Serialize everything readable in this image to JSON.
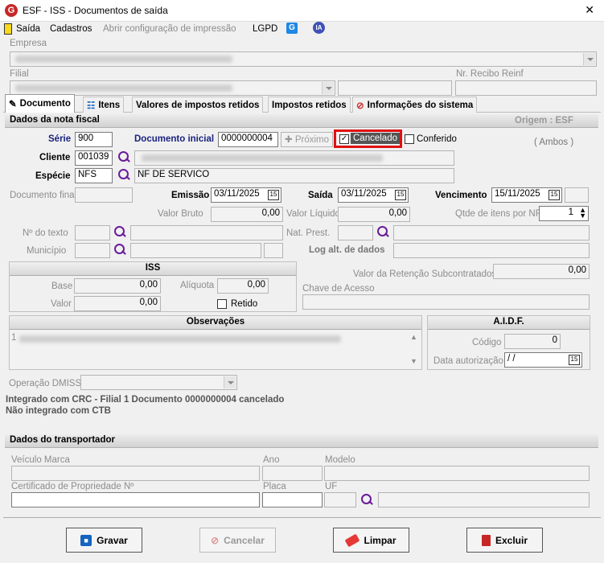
{
  "window": {
    "title": "ESF - ISS - Documentos de saída",
    "close": "✕"
  },
  "menu": {
    "saida": "Saída",
    "cadastros": "Cadastros",
    "impressao": "Abrir configuração de impressão",
    "lgpd": "LGPD",
    "ia": "IA"
  },
  "empresa": {
    "label": "Empresa"
  },
  "filial": {
    "label": "Filial",
    "recibo_label": "Nr. Recibo Reinf"
  },
  "tabs": [
    {
      "label": "Documento"
    },
    {
      "label": "Itens"
    },
    {
      "label": "Valores de impostos retidos"
    },
    {
      "label": "Impostos retidos"
    },
    {
      "label": "Informações do sistema"
    }
  ],
  "nota": {
    "header": "Dados da nota fiscal",
    "origem": "Origem : ESF",
    "serie_label": "Série",
    "serie": "900",
    "doc_inicial_label": "Documento inicial",
    "doc_inicial": "0000000004",
    "proximo": "Próximo",
    "cancelado": "Cancelado",
    "conferido": "Conferido",
    "ambos": "( Ambos )",
    "cliente_label": "Cliente",
    "cliente": "001039",
    "especie_label": "Espécie",
    "especie": "NFS",
    "especie_desc": "NF DE SERVICO",
    "doc_final_label": "Documento final",
    "emissao_label": "Emissão",
    "emissao": "03/11/2025",
    "saida_label": "Saída",
    "saida": "03/11/2025",
    "vencimento_label": "Vencimento",
    "vencimento": "15/11/2025",
    "valor_bruto_label": "Valor Bruto",
    "valor_bruto": "0,00",
    "valor_liquido_label": "Valor Líquido",
    "valor_liquido": "0,00",
    "qtde_label": "Qtde de itens por NF",
    "qtde": "1",
    "nr_texto_label": "Nº do texto",
    "nat_prest_label": "Nat. Prest.",
    "municipio_label": "Município",
    "log_label": "Log alt. de dados",
    "cal": "15"
  },
  "iss": {
    "header": "ISS",
    "base_label": "Base",
    "base": "0,00",
    "aliquota_label": "Alíquota",
    "aliquota": "0,00",
    "valor_label": "Valor",
    "valor": "0,00",
    "retido": "Retido"
  },
  "retencao": {
    "label": "Valor da Retenção Subcontratados",
    "value": "0,00",
    "chave_label": "Chave de Acesso"
  },
  "obs": {
    "header": "Observações",
    "line": "1"
  },
  "aidf": {
    "header": "A.I.D.F.",
    "codigo_label": "Código",
    "codigo": "0",
    "data_label": "Data autorização",
    "data": " /  /"
  },
  "dmiss": {
    "label": "Operação DMISS"
  },
  "status": {
    "line1": "Integrado com CRC - Filial 1 Documento 0000000004 cancelado",
    "line2": "Não integrado com CTB"
  },
  "transp": {
    "header": "Dados do transportador",
    "marca": "Veículo Marca",
    "ano": "Ano",
    "modelo": "Modelo",
    "cert": "Certificado de Propriedade Nº",
    "placa": "Placa",
    "uf": "UF"
  },
  "buttons": {
    "gravar": "Gravar",
    "cancelar": "Cancelar",
    "limpar": "Limpar",
    "excluir": "Excluir"
  }
}
